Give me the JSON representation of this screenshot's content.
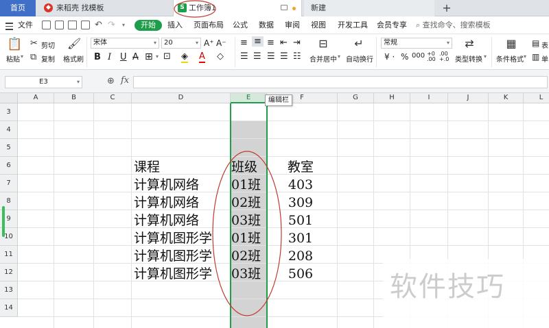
{
  "tabs": {
    "home": "首页",
    "template": "来稻壳 找模板",
    "workbook": "工作簿1",
    "new": "新建",
    "add": "+"
  },
  "menu": {
    "file": "文件",
    "start": "开始",
    "items": [
      "插入",
      "页面布局",
      "公式",
      "数据",
      "审阅",
      "视图",
      "开发工具",
      "会员专享"
    ],
    "search": "查找命令、搜索模板"
  },
  "ribbon": {
    "paste": "粘贴",
    "cut": "剪切",
    "copy": "复制",
    "format_painter": "格式刷",
    "font_name": "宋体",
    "font_size": "20",
    "bold": "B",
    "italic": "I",
    "underline": "U",
    "merge_center": "合并居中",
    "wrap_text": "自动换行",
    "number_format": "常规",
    "type_convert": "类型转换",
    "conditional_format": "条件格式",
    "table": "表",
    "single": "单"
  },
  "formula_bar": {
    "name_box": "E3",
    "fx": "fx",
    "formula": ""
  },
  "tooltip": "编辑栏",
  "columns": [
    "A",
    "B",
    "C",
    "D",
    "E",
    "F",
    "G",
    "H",
    "I",
    "J",
    "K",
    "L"
  ],
  "rows": [
    "3",
    "4",
    "5",
    "6",
    "7",
    "8",
    "9",
    "10",
    "11",
    "12",
    "13",
    "14"
  ],
  "selected_column": "E",
  "table": {
    "headers": [
      "课程",
      "班级",
      "教室"
    ],
    "rows": [
      [
        "计算机网络",
        "01班",
        "403"
      ],
      [
        "计算机网络",
        "02班",
        "309"
      ],
      [
        "计算机网络",
        "03班",
        "501"
      ],
      [
        "计算机图形学",
        "01班",
        "301"
      ],
      [
        "计算机图形学",
        "02班",
        "208"
      ],
      [
        "计算机图形学",
        "03班",
        "506"
      ]
    ]
  },
  "watermark": "软件技巧",
  "colors": {
    "accent_green": "#1e9e4a",
    "home_tab_blue": "#3f6fc6",
    "annotation_red": "#c0392b",
    "selection_fill": "#d3d3d3"
  }
}
